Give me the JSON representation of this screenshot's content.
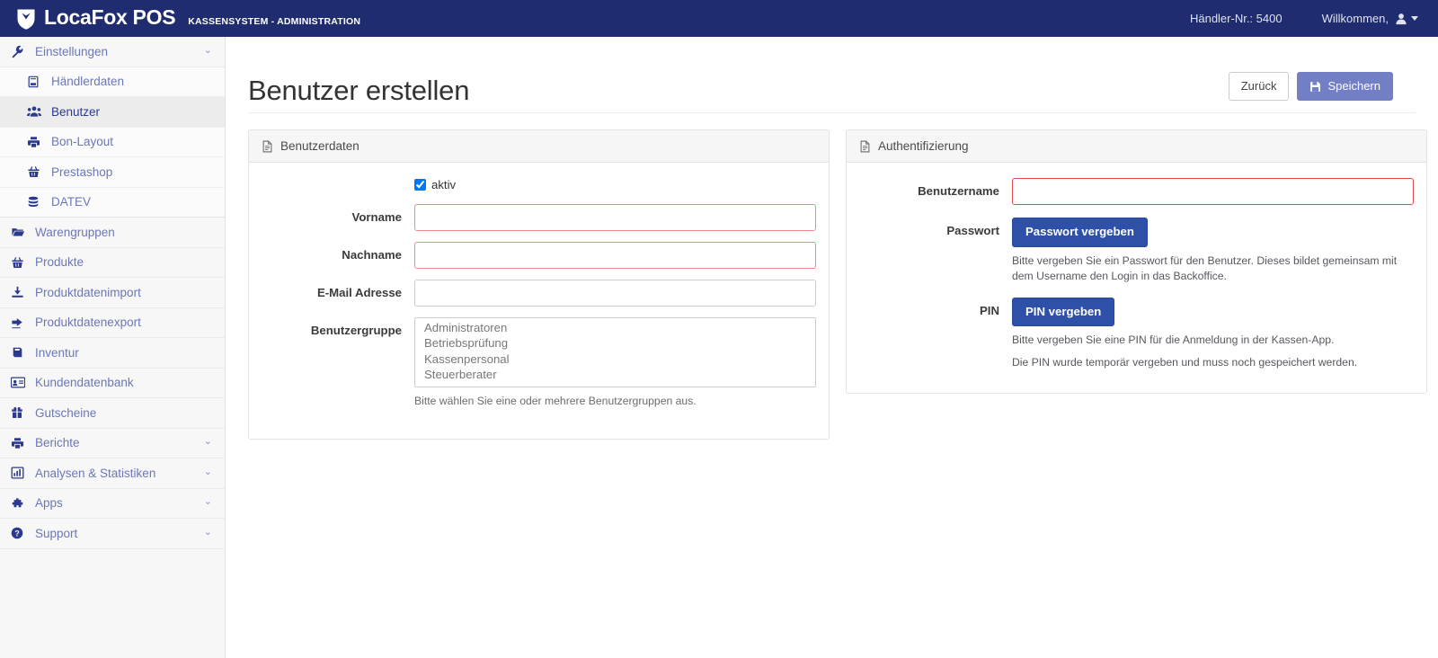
{
  "header": {
    "brand_name": "LocaFox POS",
    "brand_subtitle": "KASSENSYSTEM - ADMINISTRATION",
    "merchant_number": "Händler-Nr.: 5400",
    "welcome_label": "Willkommen,",
    "brand_bg": "#1f2c70"
  },
  "sidebar": {
    "items": [
      {
        "label": "Einstellungen",
        "icon": "wrench-icon",
        "chevron": "⌄",
        "level": "top",
        "active": false
      },
      {
        "label": "Händlerdaten",
        "icon": "ledger-icon",
        "chevron": "",
        "level": "sub",
        "active": false
      },
      {
        "label": "Benutzer",
        "icon": "users-icon",
        "chevron": "",
        "level": "sub",
        "active": true
      },
      {
        "label": "Bon-Layout",
        "icon": "printer-icon",
        "chevron": "",
        "level": "sub",
        "active": false
      },
      {
        "label": "Prestashop",
        "icon": "basket-icon",
        "chevron": "",
        "level": "sub",
        "active": false
      },
      {
        "label": "DATEV",
        "icon": "database-icon",
        "chevron": "",
        "level": "sub",
        "active": false
      },
      {
        "label": "Warengruppen",
        "icon": "folder-open-icon",
        "chevron": "",
        "level": "top",
        "active": false
      },
      {
        "label": "Produkte",
        "icon": "basket-icon",
        "chevron": "",
        "level": "top",
        "active": false
      },
      {
        "label": "Produktdatenimport",
        "icon": "download-icon",
        "chevron": "",
        "level": "top",
        "active": false
      },
      {
        "label": "Produktdatenexport",
        "icon": "share-icon",
        "chevron": "",
        "level": "top",
        "active": false
      },
      {
        "label": "Inventur",
        "icon": "book-icon",
        "chevron": "",
        "level": "top",
        "active": false
      },
      {
        "label": "Kundendatenbank",
        "icon": "id-card-icon",
        "chevron": "",
        "level": "top",
        "active": false
      },
      {
        "label": "Gutscheine",
        "icon": "gift-icon",
        "chevron": "",
        "level": "top",
        "active": false
      },
      {
        "label": "Berichte",
        "icon": "printer-icon",
        "chevron": "⌄",
        "level": "top",
        "active": false
      },
      {
        "label": "Analysen & Statistiken",
        "icon": "bar-chart-icon",
        "chevron": "⌄",
        "level": "top",
        "active": false
      },
      {
        "label": "Apps",
        "icon": "puzzle-icon",
        "chevron": "⌄",
        "level": "top",
        "active": false
      },
      {
        "label": "Support",
        "icon": "question-circle-icon",
        "chevron": "⌄",
        "level": "top",
        "active": false
      }
    ]
  },
  "page": {
    "title": "Benutzer erstellen",
    "back_button": "Zurück",
    "save_button": "Speichern",
    "save_button_color": "#737fc4"
  },
  "user_panel": {
    "title": "Benutzerdaten",
    "active_checkbox_label": "aktiv",
    "active_checked": true,
    "fields": [
      {
        "label": "Vorname",
        "value": "",
        "placeholder": "",
        "error": true
      },
      {
        "label": "Nachname",
        "value": "",
        "placeholder": "",
        "error": true
      },
      {
        "label": "E-Mail Adresse",
        "value": "",
        "placeholder": "",
        "error": false
      }
    ],
    "group_label": "Benutzergruppe",
    "group_options": [
      "Administratoren",
      "Betriebsprüfung",
      "Kassenpersonal",
      "Steuerberater"
    ],
    "group_help": "Bitte wählen Sie eine oder mehrere Benutzergruppen aus."
  },
  "auth_panel": {
    "title": "Authentifizierung",
    "username_label": "Benutzername",
    "username_value": "",
    "username_error": true,
    "password_label": "Passwort",
    "password_button": "Passwort vergeben",
    "password_help": "Bitte vergeben Sie ein Passwort für den Benutzer. Dieses bildet gemeinsam mit dem Username den Login in das Backoffice.",
    "pin_label": "PIN",
    "pin_button": "PIN vergeben",
    "pin_help_1": "Bitte vergeben Sie eine PIN für die Anmeldung in der Kassen-App.",
    "pin_help_2": "Die PIN wurde temporär vergeben und muss noch gespeichert werden.",
    "button_color": "#2f50a8"
  }
}
